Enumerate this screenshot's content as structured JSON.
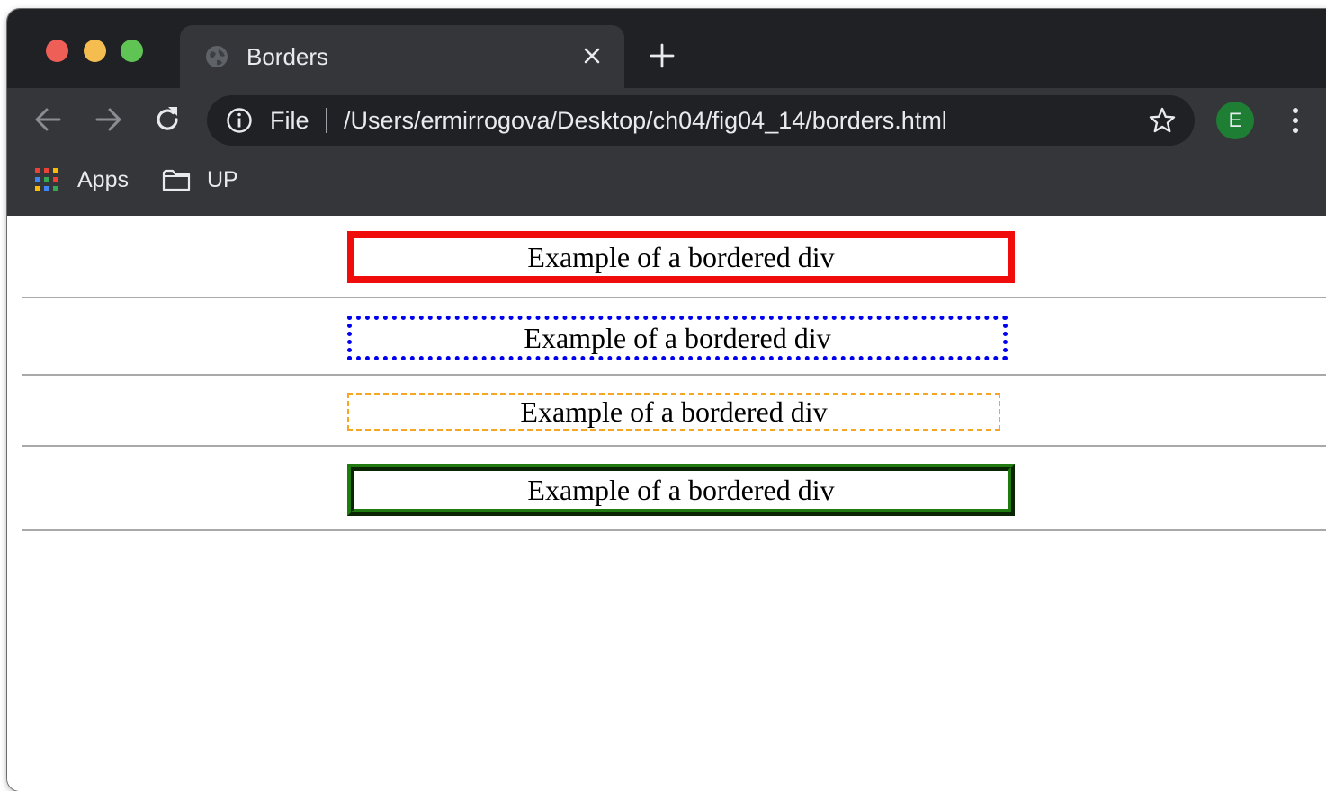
{
  "window": {
    "title": "Borders"
  },
  "tabs": [
    {
      "title": "Borders",
      "active": true
    }
  ],
  "toolbar": {
    "back_icon": "arrow-left-icon",
    "forward_icon": "arrow-right-icon",
    "reload_icon": "reload-icon"
  },
  "omnibox": {
    "scheme_label": "File",
    "url": "/Users/ermirrogova/Desktop/ch04/fig04_14/borders.html",
    "bookmark_icon": "star-icon"
  },
  "profile": {
    "initial": "E",
    "color": "#1e7e34"
  },
  "bookmarks": [
    {
      "label": "Apps",
      "icon": "apps-grid-icon"
    },
    {
      "label": "UP",
      "icon": "folder-icon"
    }
  ],
  "page": {
    "divs": [
      {
        "text": "Example of a bordered div",
        "border_color": "#f10c0c",
        "border_style": "solid"
      },
      {
        "text": "Example of a bordered div",
        "border_color": "#0000f0",
        "border_style": "dotted"
      },
      {
        "text": "Example of a bordered div",
        "border_color": "#f5a623",
        "border_style": "dashed"
      },
      {
        "text": "Example of a bordered div",
        "border_color": "#1f7a10",
        "border_style": "ridge"
      }
    ]
  }
}
